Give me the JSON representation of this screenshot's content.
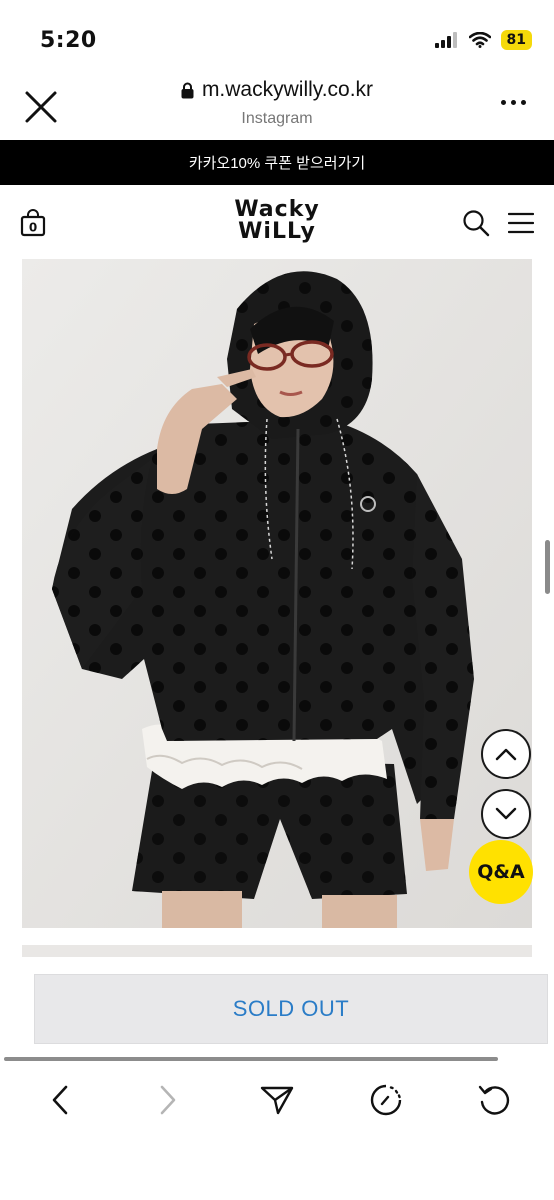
{
  "status": {
    "time": "5:20",
    "battery": "81"
  },
  "browser": {
    "url": "m.wackywilly.co.kr",
    "source": "Instagram"
  },
  "promo": {
    "text": "카카오10% 쿠폰 받으러가기"
  },
  "header": {
    "logo_line1": "Wacky",
    "logo_line2": "WiLLy",
    "cart_count": "0"
  },
  "product": {
    "sold_out_label": "SOLD OUT"
  },
  "floating": {
    "qa_label": "Q&A"
  },
  "colors": {
    "promo_bg": "#000000",
    "qa_yellow": "#ffe100",
    "soldout_text": "#2a7cc7",
    "battery_yellow": "#f5d90a"
  },
  "icons": [
    "signal-icon",
    "wifi-icon",
    "lock-icon",
    "close-icon",
    "more-icon",
    "cart-icon",
    "search-icon",
    "menu-icon",
    "chevron-up-icon",
    "chevron-down-icon",
    "back-icon",
    "forward-icon",
    "share-icon",
    "history-icon",
    "reload-icon"
  ]
}
